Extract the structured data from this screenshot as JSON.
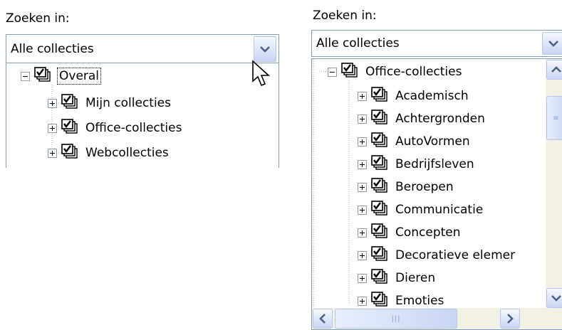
{
  "left": {
    "search_label": "Zoeken in:",
    "combo_value": "Alle collecties",
    "tree": [
      {
        "label": "Overal",
        "expander": "minus",
        "selected": true
      },
      {
        "label": "Mijn collecties",
        "expander": "plus"
      },
      {
        "label": "Office-collecties",
        "expander": "plus"
      },
      {
        "label": "Webcollecties",
        "expander": "plus"
      }
    ]
  },
  "right": {
    "search_label": "Zoeken in:",
    "combo_value": "Alle collecties",
    "root": {
      "label": "Office-collecties",
      "expander": "minus"
    },
    "children": [
      {
        "label": "Academisch"
      },
      {
        "label": "Achtergronden"
      },
      {
        "label": "AutoVormen"
      },
      {
        "label": "Bedrijfsleven"
      },
      {
        "label": "Beroepen"
      },
      {
        "label": "Communicatie"
      },
      {
        "label": "Concepten"
      },
      {
        "label": "Decoratieve elemer"
      },
      {
        "label": "Dieren"
      },
      {
        "label": "Emoties"
      }
    ]
  },
  "icons": {
    "dropdown": "chevron-down-icon",
    "checkbox": "checked-collection-icon",
    "cursor": "mouse-pointer-icon"
  },
  "colors": {
    "border": "#7f9db9",
    "scroll_track": "#f3f1e6",
    "button_blue": "#c7d5f5",
    "arrow": "#4d6185"
  }
}
